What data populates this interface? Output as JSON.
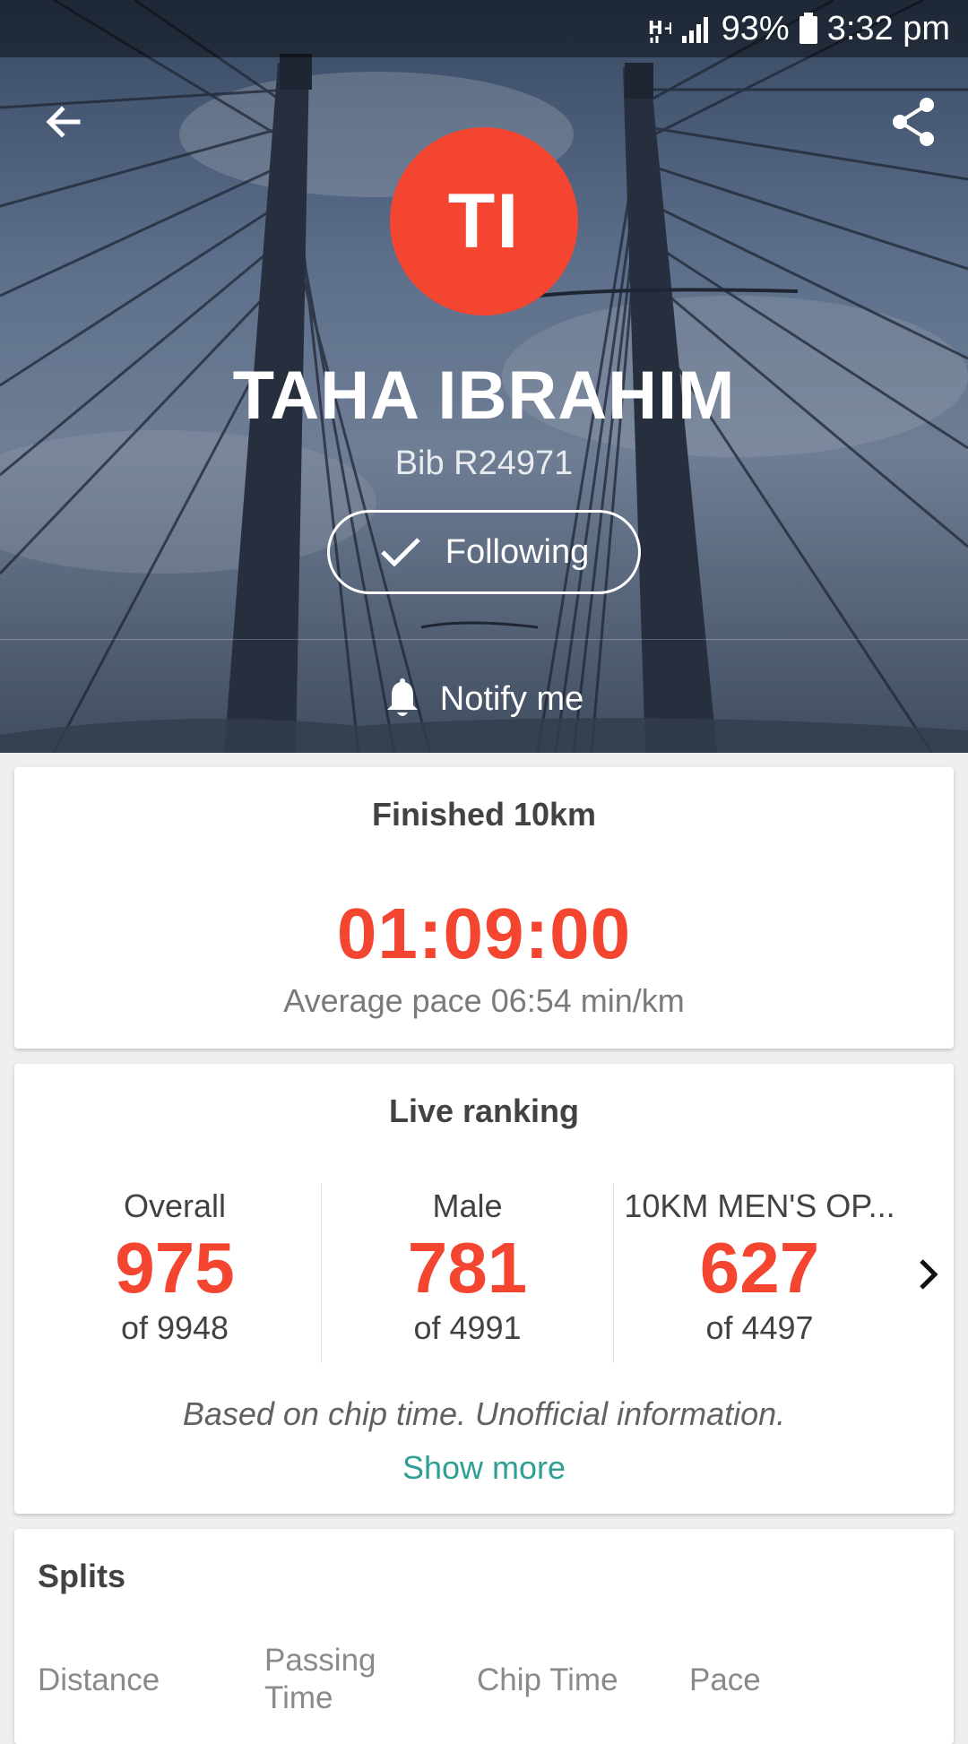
{
  "status_bar": {
    "network": "H+",
    "battery": "93%",
    "time": "3:32 pm"
  },
  "header": {
    "back_icon": "arrow-left-icon",
    "share_icon": "share-icon"
  },
  "runner": {
    "initials": "TI",
    "name": "TAHA IBRAHIM",
    "bib": "Bib R24971",
    "avatar_color": "#f44530"
  },
  "actions": {
    "following_label": "Following",
    "notify_label": "Notify me"
  },
  "finish": {
    "title": "Finished 10km",
    "time": "01:09:00",
    "average_pace": "Average pace 06:54 min/km"
  },
  "ranking": {
    "title": "Live ranking",
    "columns": [
      {
        "label": "Overall",
        "rank": "975",
        "total": "of 9948"
      },
      {
        "label": "Male",
        "rank": "781",
        "total": "of 4991"
      },
      {
        "label": "10KM MEN'S OP...",
        "rank": "627",
        "total": "of 4497"
      }
    ],
    "note": "Based on chip time. Unofficial information.",
    "show_more": "Show more"
  },
  "splits": {
    "title": "Splits",
    "columns": [
      "Distance",
      "Passing Time",
      "Chip Time",
      "Pace"
    ]
  },
  "colors": {
    "accent": "#f44530",
    "link": "#2f9f94",
    "text_dark": "#424242",
    "text_muted": "#7a7a7a"
  }
}
